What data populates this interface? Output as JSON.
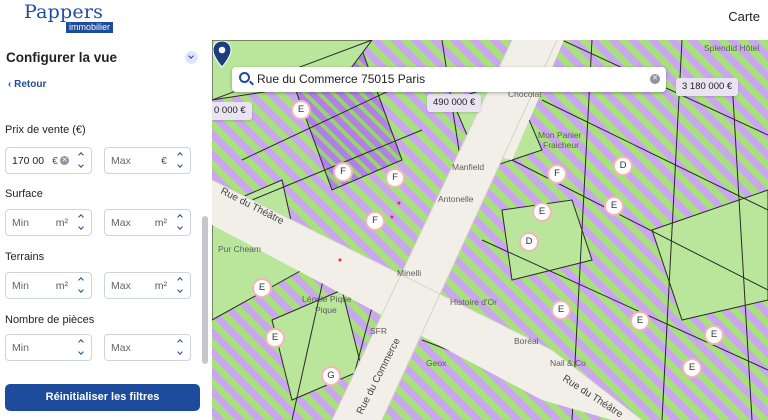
{
  "header": {
    "logo_main": "Pappers",
    "logo_sub": "immobilier",
    "carte_label": "Carte"
  },
  "sidebar": {
    "title": "Configurer la vue",
    "back_label": "Retour",
    "price_label": "Prix de vente (€)",
    "price_min_value": "170 00",
    "price_min_unit": "€",
    "price_max_placeholder": "Max",
    "price_max_unit": "€",
    "surface_label": "Surface",
    "surface_min_placeholder": "Min",
    "surface_min_unit": "m²",
    "surface_max_placeholder": "Max",
    "surface_max_unit": "m²",
    "terrains_label": "Terrains",
    "terrains_min_placeholder": "Min",
    "terrains_min_unit": "m²",
    "terrains_max_placeholder": "Max",
    "terrains_max_unit": "m²",
    "rooms_label": "Nombre de pièces",
    "rooms_min_placeholder": "Min",
    "rooms_max_placeholder": "Max",
    "reset_label": "Réinitialiser les filtres"
  },
  "map": {
    "search_value": "Rue du Commerce 75015 Paris",
    "price_labels": [
      "490 000 €",
      "3 180 000 €",
      "0 000 €"
    ],
    "dpe_badges": [
      "F",
      "F",
      "F",
      "D",
      "F",
      "E",
      "E",
      "D",
      "E",
      "E",
      "E",
      "E",
      "E",
      "E",
      "G",
      "E"
    ],
    "street_labels": [
      "Rue du Théâtre",
      "Rue du Commerce",
      "Rue du Théâtre"
    ],
    "poi_labels": [
      "Manfield",
      "Antonelle",
      "Mon Panier",
      "Fraicheur",
      "Splendid Hôtel",
      "Chocolat",
      "Minelli",
      "Histoire d'Or",
      "Boréal",
      "Nail & Co",
      "SFR",
      "Geox",
      "Léonie Pique",
      "Pique",
      "Pur Cheam"
    ],
    "colors": {
      "parcel_green": "#9bdc72",
      "stripe_purple": "#c9a6ef",
      "street": "#f1efe7",
      "accent_blue": "#1d4c9c"
    }
  }
}
